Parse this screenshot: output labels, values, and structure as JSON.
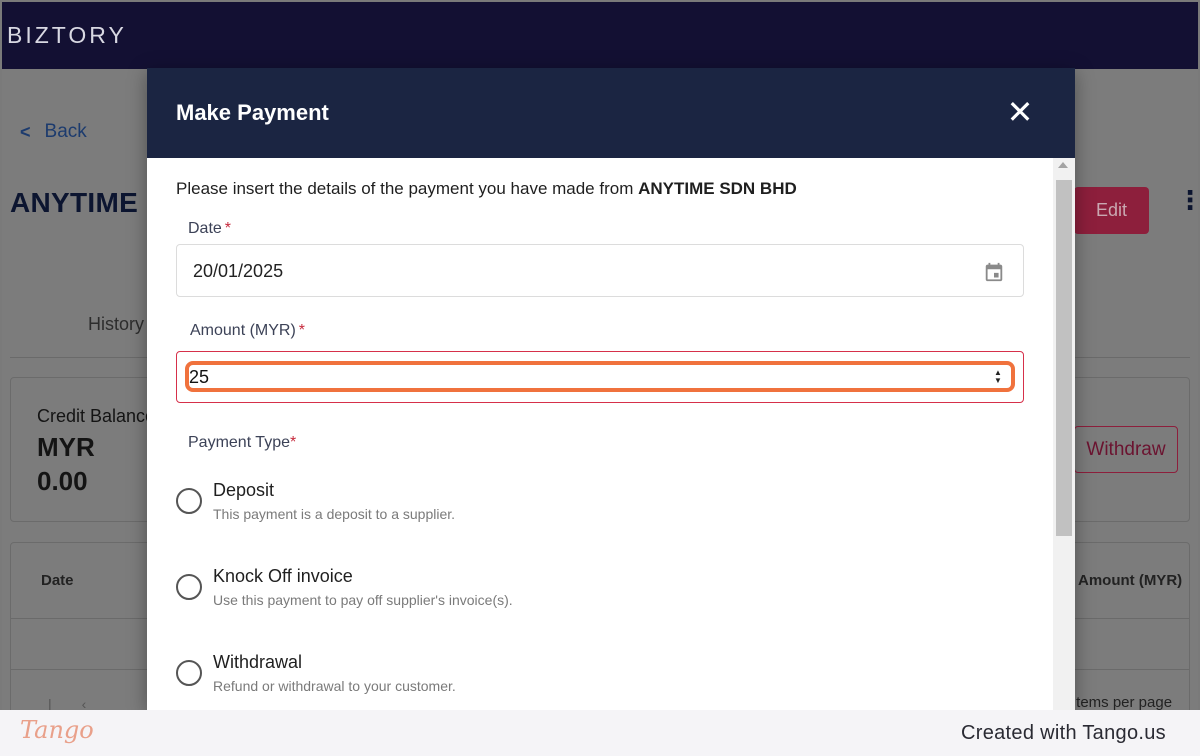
{
  "app": {
    "logo": "BIZTORY"
  },
  "background": {
    "back_label": "Back",
    "company_name": "ANYTIME S",
    "edit_label": "Edit",
    "more_label": "⋮",
    "tab_history": "History",
    "credit_label": "Credit Balance",
    "credit_currency": "MYR",
    "credit_value": "0.00",
    "withdraw_label": "Withdraw",
    "table_header_date": "Date",
    "table_header_amount": "Amount (MYR)",
    "items_per_page": "Items per page",
    "pager": "|‹ ‹"
  },
  "modal": {
    "title": "Make Payment",
    "close_label": "✕",
    "intro_prefix": "Please insert the details of the payment you have made from ",
    "intro_company": "ANYTIME SDN BHD",
    "date_label": "Date",
    "date_value": "20/01/2025",
    "amount_label": "Amount (MYR)",
    "amount_value": "25",
    "payment_type_label": "Payment Type",
    "required_mark": "*",
    "options": [
      {
        "title": "Deposit",
        "description": "This payment is a deposit to a supplier."
      },
      {
        "title": "Knock Off invoice",
        "description": "Use this payment to pay off supplier's invoice(s)."
      },
      {
        "title": "Withdrawal",
        "description": "Refund or withdrawal to your customer."
      }
    ]
  },
  "footer": {
    "brand": "Tango",
    "created_with": "Created with Tango.us"
  },
  "colors": {
    "topbar": "#131033",
    "modal_header": "#1b2542",
    "required": "#c62a3c",
    "highlight": "#f0723d"
  }
}
